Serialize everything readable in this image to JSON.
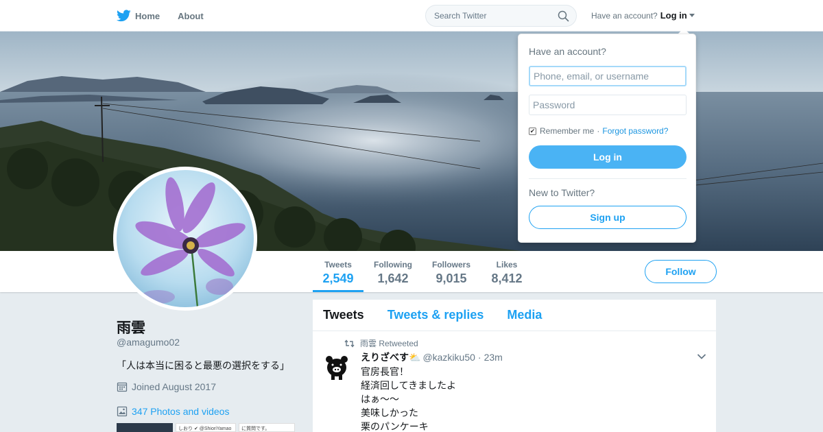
{
  "nav": {
    "home_label": "Home",
    "about_label": "About",
    "search_placeholder": "Search Twitter",
    "have_account": "Have an account?",
    "login_label": "Log in"
  },
  "profile": {
    "name": "雨雲",
    "handle": "@amagumo02",
    "bio": "「人は本当に困ると最悪の選択をする」",
    "joined": "Joined August 2017",
    "photos": "347 Photos and videos",
    "thumb2_text": "しおり ✔ @ShioriYamao",
    "thumb3_text": "に質問です。"
  },
  "stats": [
    {
      "label": "Tweets",
      "value": "2,549"
    },
    {
      "label": "Following",
      "value": "1,642"
    },
    {
      "label": "Followers",
      "value": "9,015"
    },
    {
      "label": "Likes",
      "value": "8,412"
    }
  ],
  "follow_label": "Follow",
  "timeline": {
    "tabs": [
      "Tweets",
      "Tweets & replies",
      "Media"
    ],
    "retweet_line": "雨雲 Retweeted",
    "tweet": {
      "name": "えりざべす⛅",
      "handle": "@kazkiku50",
      "sep": "·",
      "time": "23m",
      "lines": [
        "官房長官！",
        "経済回してきましたよ",
        "はぁ〜〜",
        "美味しかった",
        "栗のパンケーキ"
      ]
    }
  },
  "login_dropdown": {
    "title": "Have an account?",
    "username_placeholder": "Phone, email, or username",
    "password_placeholder": "Password",
    "remember": "Remember me",
    "dot": "·",
    "forgot": "Forgot password?",
    "login_button": "Log in",
    "new_to": "New to Twitter?",
    "signup_button": "Sign up"
  },
  "colors": {
    "accent": "#1da1f2",
    "login_button": "#4ab3f4",
    "background": "#e6ecf0"
  },
  "icons": {
    "brand": "twitter-bird-icon",
    "home": "home-bird-icon",
    "search": "search-icon",
    "calendar": "calendar-icon",
    "photos": "image-icon",
    "retweet": "retweet-icon",
    "chevron": "chevron-down-icon"
  }
}
